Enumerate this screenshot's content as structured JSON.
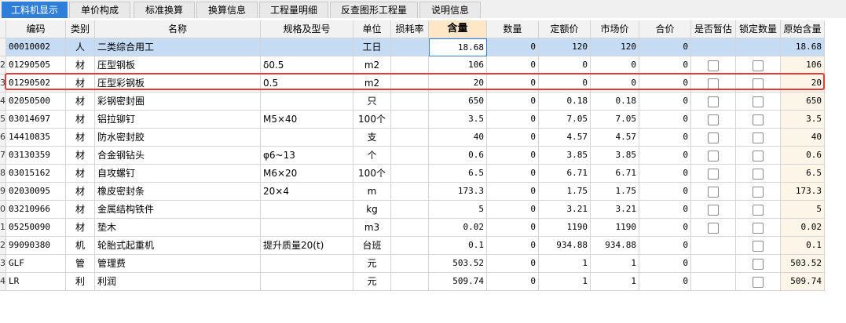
{
  "tabs": [
    "工料机显示",
    "单价构成",
    "标准换算",
    "换算信息",
    "工程量明细",
    "反查图形工程量",
    "说明信息"
  ],
  "active_tab": 0,
  "columns": [
    "编码",
    "类别",
    "名称",
    "规格及型号",
    "单位",
    "损耗率",
    "含量",
    "数量",
    "定额价",
    "市场价",
    "合价",
    "是否暂估",
    "锁定数量",
    "原始含量"
  ],
  "rows": [
    {
      "num": "",
      "code": "00010002",
      "type": "人",
      "name": "二类综合用工",
      "spec": "",
      "unit": "工日",
      "loss": "",
      "qty": "18.68",
      "amount": "0",
      "quota": "120",
      "market": "120",
      "total": "0",
      "est": false,
      "lock": false,
      "orig": "18.68"
    },
    {
      "num": "2",
      "code": "01290505",
      "type": "材",
      "name": "压型钢板",
      "spec": "δ0.5",
      "unit": "m2",
      "loss": "",
      "qty": "106",
      "amount": "0",
      "quota": "0",
      "market": "0",
      "total": "0",
      "est": true,
      "lock": true,
      "orig": "106"
    },
    {
      "num": "3",
      "code": "01290502",
      "type": "材",
      "name": "压型彩钢板",
      "spec": "0.5",
      "unit": "m2",
      "loss": "",
      "qty": "20",
      "amount": "0",
      "quota": "0",
      "market": "0",
      "total": "0",
      "est": true,
      "lock": true,
      "orig": "20"
    },
    {
      "num": "4",
      "code": "02050500",
      "type": "材",
      "name": "彩钢密封圈",
      "spec": "",
      "unit": "只",
      "loss": "",
      "qty": "650",
      "amount": "0",
      "quota": "0.18",
      "market": "0.18",
      "total": "0",
      "est": true,
      "lock": true,
      "orig": "650"
    },
    {
      "num": "5",
      "code": "03014697",
      "type": "材",
      "name": "铝拉铆钉",
      "spec": "M5×40",
      "unit": "100个",
      "loss": "",
      "qty": "3.5",
      "amount": "0",
      "quota": "7.05",
      "market": "7.05",
      "total": "0",
      "est": true,
      "lock": true,
      "orig": "3.5"
    },
    {
      "num": "6",
      "code": "14410835",
      "type": "材",
      "name": "防水密封胶",
      "spec": "",
      "unit": "支",
      "loss": "",
      "qty": "40",
      "amount": "0",
      "quota": "4.57",
      "market": "4.57",
      "total": "0",
      "est": true,
      "lock": true,
      "orig": "40"
    },
    {
      "num": "7",
      "code": "03130359",
      "type": "材",
      "name": "合金钢钻头",
      "spec": "φ6~13",
      "unit": "个",
      "loss": "",
      "qty": "0.6",
      "amount": "0",
      "quota": "3.85",
      "market": "3.85",
      "total": "0",
      "est": true,
      "lock": true,
      "orig": "0.6"
    },
    {
      "num": "8",
      "code": "03015162",
      "type": "材",
      "name": "自攻螺钉",
      "spec": "M6×20",
      "unit": "100个",
      "loss": "",
      "qty": "6.5",
      "amount": "0",
      "quota": "6.71",
      "market": "6.71",
      "total": "0",
      "est": true,
      "lock": true,
      "orig": "6.5"
    },
    {
      "num": "9",
      "code": "02030095",
      "type": "材",
      "name": "橡皮密封条",
      "spec": "20×4",
      "unit": "m",
      "loss": "",
      "qty": "173.3",
      "amount": "0",
      "quota": "1.75",
      "market": "1.75",
      "total": "0",
      "est": true,
      "lock": true,
      "orig": "173.3"
    },
    {
      "num": "0",
      "code": "03210966",
      "type": "材",
      "name": "金属结构铁件",
      "spec": "",
      "unit": "kg",
      "loss": "",
      "qty": "5",
      "amount": "0",
      "quota": "3.21",
      "market": "3.21",
      "total": "0",
      "est": true,
      "lock": true,
      "orig": "5"
    },
    {
      "num": "1",
      "code": "05250090",
      "type": "材",
      "name": "垫木",
      "spec": "",
      "unit": "m3",
      "loss": "",
      "qty": "0.02",
      "amount": "0",
      "quota": "1190",
      "market": "1190",
      "total": "0",
      "est": true,
      "lock": true,
      "orig": "0.02"
    },
    {
      "num": "2",
      "code": "99090380",
      "type": "机",
      "name": "轮胎式起重机",
      "spec": "提升质量20(t)",
      "unit": "台班",
      "loss": "",
      "qty": "0.1",
      "amount": "0",
      "quota": "934.88",
      "market": "934.88",
      "total": "0",
      "est": false,
      "lock": true,
      "orig": "0.1"
    },
    {
      "num": "3",
      "code": "GLF",
      "type": "管",
      "name": "管理费",
      "spec": "",
      "unit": "元",
      "loss": "",
      "qty": "503.52",
      "amount": "0",
      "quota": "1",
      "market": "1",
      "total": "0",
      "est": false,
      "lock": true,
      "orig": "503.52"
    },
    {
      "num": "4",
      "code": "LR",
      "type": "利",
      "name": "利润",
      "spec": "",
      "unit": "元",
      "loss": "",
      "qty": "509.74",
      "amount": "0",
      "quota": "1",
      "market": "1",
      "total": "0",
      "est": false,
      "lock": true,
      "orig": "509.74"
    }
  ]
}
